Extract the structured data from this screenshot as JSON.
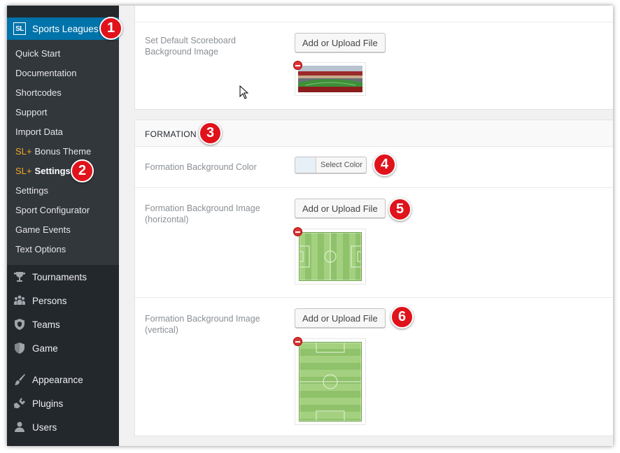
{
  "sidebar": {
    "logo_text": "SL",
    "header_label": "Sports Leagues",
    "submenu": [
      {
        "label": "Quick Start"
      },
      {
        "label": "Documentation"
      },
      {
        "label": "Shortcodes"
      },
      {
        "label": "Support"
      },
      {
        "label": "Import Data"
      },
      {
        "prefix": "SL+",
        "label": "Bonus Theme"
      },
      {
        "prefix": "SL+",
        "label": "Settings"
      },
      {
        "label": "Settings"
      },
      {
        "label": "Sport Configurator"
      },
      {
        "label": "Game Events"
      },
      {
        "label": "Text Options"
      }
    ],
    "menu": [
      {
        "label": "Tournaments",
        "icon": "trophy-icon"
      },
      {
        "label": "Persons",
        "icon": "persons-icon"
      },
      {
        "label": "Teams",
        "icon": "shield-icon"
      },
      {
        "label": "Game",
        "icon": "game-shield-icon"
      },
      {
        "label": "Appearance",
        "icon": "paintbrush-icon"
      },
      {
        "label": "Plugins",
        "icon": "plug-icon"
      },
      {
        "label": "Users",
        "icon": "user-icon"
      }
    ]
  },
  "scoreboard": {
    "label": "Set Default Scoreboard Background Image",
    "button": "Add or Upload File"
  },
  "formation": {
    "title": "FORMATION",
    "color_label": "Formation Background Color",
    "color_button": "Select Color",
    "color_value": "#e8f0f7",
    "horizontal_label": "Formation Background Image (horizontal)",
    "horizontal_button": "Add or Upload File",
    "vertical_label": "Formation Background Image (vertical)",
    "vertical_button": "Add or Upload File"
  },
  "badges": [
    "1",
    "2",
    "3",
    "4",
    "5",
    "6"
  ],
  "colors": {
    "sidebar_bg": "#23282d",
    "submenu_bg": "#32373c",
    "active_bg": "#0073aa",
    "accent_prefix": "#f5a623",
    "badge": "#e0121b",
    "pitch": "#8fc26a"
  }
}
